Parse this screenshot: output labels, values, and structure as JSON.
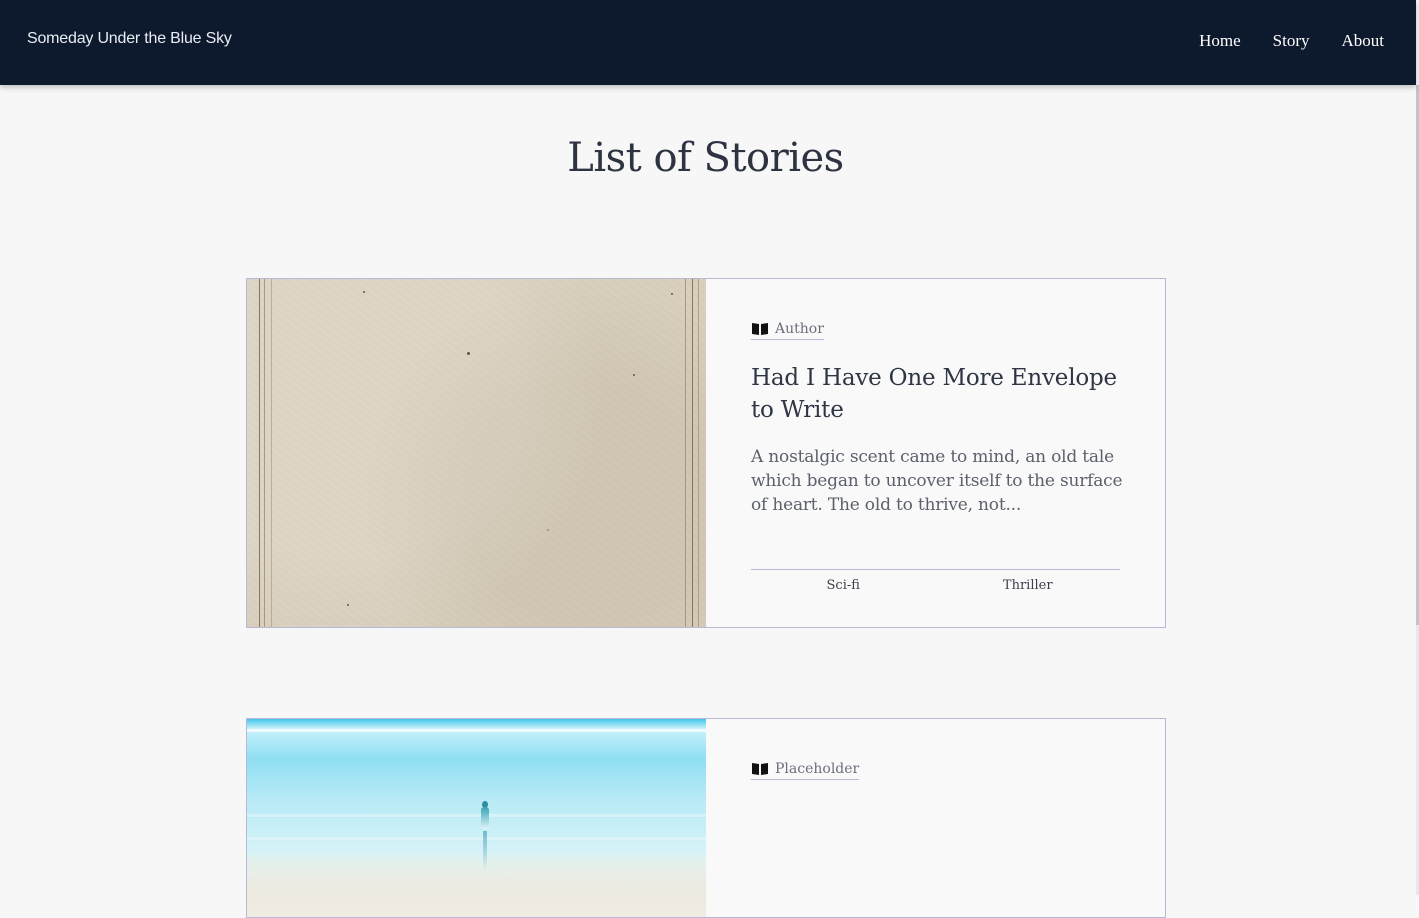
{
  "nav": {
    "brand": "Someday Under the Blue Sky",
    "links": [
      "Home",
      "Story",
      "About"
    ]
  },
  "page": {
    "title": "List of Stories"
  },
  "stories": [
    {
      "tag_icon": "book-icon",
      "tag": "Author",
      "title": "Had I Have One More Envelope to Write",
      "excerpt": "A nostalgic scent came to mind, an old tale which began to uncover itself to the surface of heart. The old to thrive, not...",
      "genres": [
        "Sci-fi",
        "Thriller"
      ]
    },
    {
      "tag_icon": "book-icon",
      "tag": "Placeholder"
    }
  ],
  "colors": {
    "nav_bg": "#0d1a2d",
    "page_bg": "#f7f7f7",
    "card_border": "#b9b8d8",
    "title_text": "#2d3340"
  }
}
